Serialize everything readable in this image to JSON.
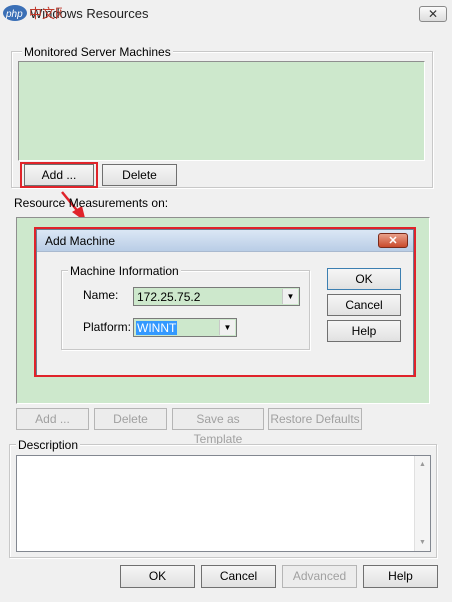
{
  "window": {
    "title": "Windows Resources",
    "close_glyph": "✕",
    "watermark": "php 中文网"
  },
  "monitored": {
    "label": "Monitored Server Machines",
    "add_label": "Add ...",
    "delete_label": "Delete"
  },
  "resource": {
    "label": "Resource Measurements on:",
    "add_label": "Add ...",
    "delete_label": "Delete",
    "template_label": "Save as Template",
    "restore_label": "Restore Defaults"
  },
  "dialog": {
    "title": "Add Machine",
    "close_glyph": "✕",
    "group_label": "Machine Information",
    "name_label": "Name:",
    "name_value": "172.25.75.2",
    "platform_label": "Platform:",
    "platform_value": "WINNT",
    "ok_label": "OK",
    "cancel_label": "Cancel",
    "help_label": "Help"
  },
  "description": {
    "label": "Description"
  },
  "footer": {
    "ok_label": "OK",
    "cancel_label": "Cancel",
    "advanced_label": "Advanced",
    "help_label": "Help"
  },
  "colors": {
    "panel_green": "#cde8cc",
    "highlight_red": "#e0232a",
    "selection_blue": "#3399ff"
  }
}
